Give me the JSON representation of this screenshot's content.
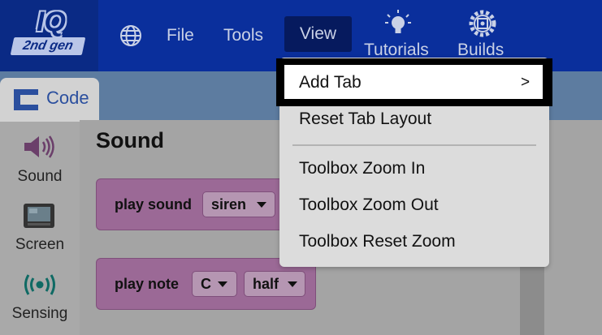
{
  "logo": {
    "mark": "IQ",
    "sub": "2nd gen"
  },
  "menubar": {
    "file": "File",
    "tools": "Tools",
    "view": "View",
    "tutorials": "Tutorials",
    "builds": "Builds"
  },
  "code_tab": {
    "label": "Code"
  },
  "categories": [
    {
      "label": "Sound",
      "icon": "speaker-icon"
    },
    {
      "label": "Screen",
      "icon": "screen-icon"
    },
    {
      "label": "Sensing",
      "icon": "sensing-icon"
    }
  ],
  "workspace": {
    "title": "Sound",
    "blocks": [
      {
        "text": "play sound",
        "dropdowns": [
          "siren"
        ]
      },
      {
        "text": "play note",
        "dropdowns": [
          "C",
          "half"
        ]
      }
    ]
  },
  "view_menu": {
    "items": [
      "Add Tab",
      "Reset Tab Layout",
      "Toolbox Zoom In",
      "Toolbox Zoom Out",
      "Toolbox Reset Zoom"
    ],
    "submenu_indicator": ">"
  },
  "colors": {
    "topbar": "#0a2f9c",
    "view_active": "#061a5e",
    "block": "#9b6996",
    "code_label": "#2b4f9e"
  }
}
